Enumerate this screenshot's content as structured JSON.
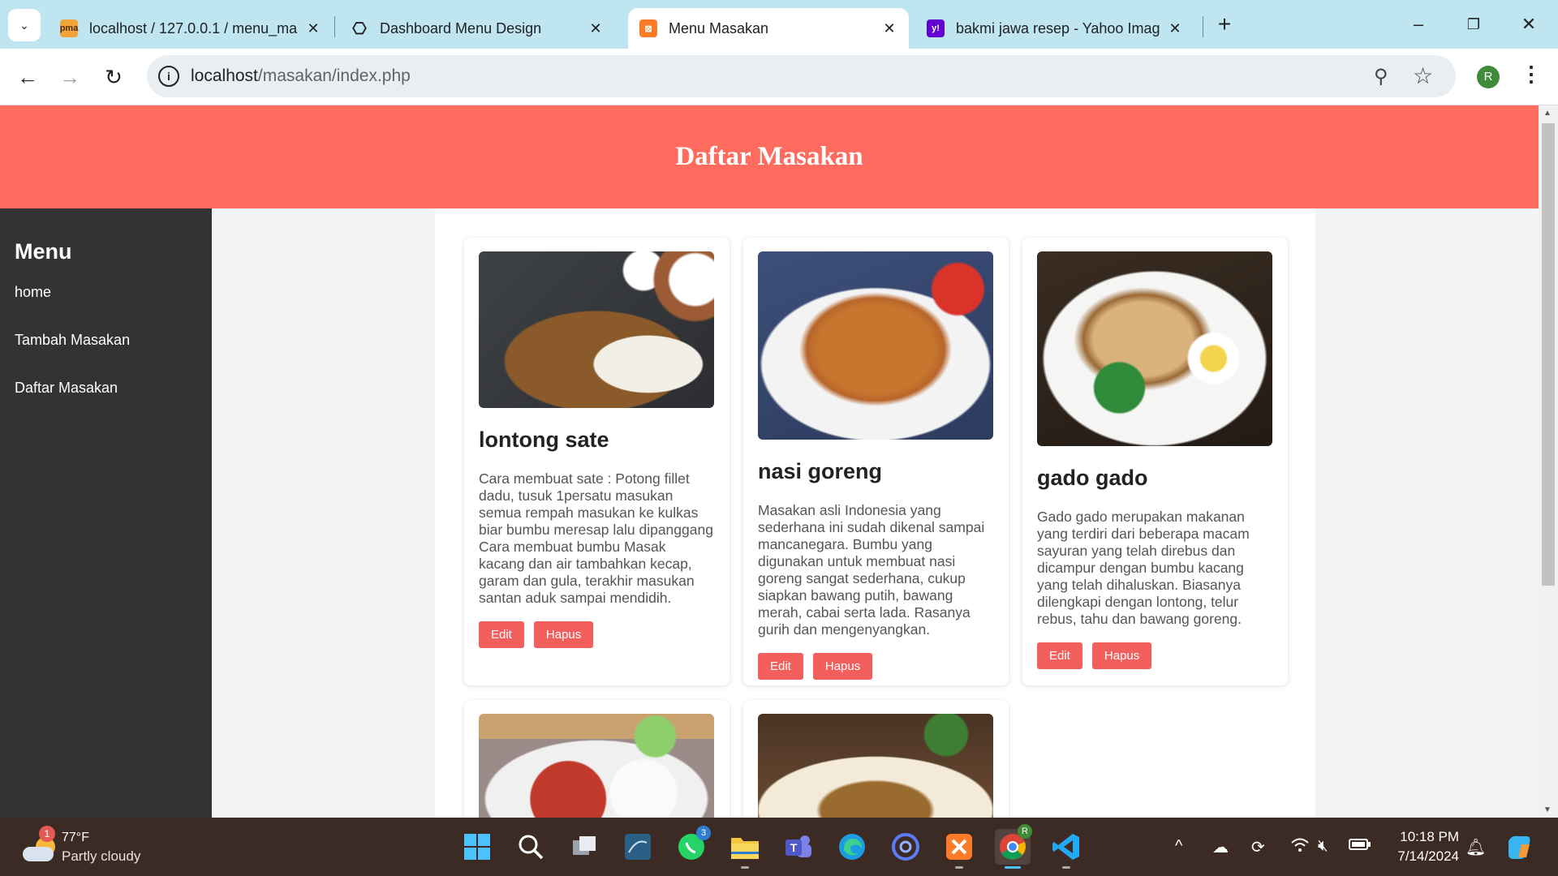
{
  "browser": {
    "tabs": [
      {
        "title": "localhost / 127.0.0.1 / menu_ma",
        "icon": "phpmyadmin-icon",
        "active": false
      },
      {
        "title": "Dashboard Menu Design",
        "icon": "chatgpt-icon",
        "active": false
      },
      {
        "title": "Menu Masakan",
        "icon": "xampp-icon",
        "active": true
      },
      {
        "title": "bakmi jawa resep - Yahoo Imag",
        "icon": "yahoo-icon",
        "active": false
      }
    ],
    "url_host": "localhost",
    "url_path": "/masakan/index.php",
    "profile_initial": "R"
  },
  "page": {
    "header_title": "Daftar Masakan",
    "sidebar": {
      "title": "Menu",
      "items": [
        "home",
        "Tambah Masakan",
        "Daftar Masakan"
      ]
    },
    "recipes": [
      {
        "name": "lontong sate",
        "description": "Cara membuat sate : Potong fillet dadu, tusuk 1persatu masukan semua rempah masukan ke kulkas biar bumbu meresap lalu dipanggang Cara membuat bumbu Masak kacang dan air tambahkan kecap, garam dan gula, terakhir masukan santan aduk sampai mendidih.",
        "image": "lontong-sate-photo"
      },
      {
        "name": "nasi goreng",
        "description": "Masakan asli Indonesia yang sederhana ini sudah dikenal sampai mancanegara. Bumbu yang digunakan untuk membuat nasi goreng sangat sederhana, cukup siapkan bawang putih, bawang merah, cabai serta lada. Rasanya gurih dan mengenyangkan.",
        "image": "nasi-goreng-photo"
      },
      {
        "name": "gado gado",
        "description": "Gado gado merupakan makanan yang terdiri dari beberapa macam sayuran yang telah direbus dan dicampur dengan bumbu kacang yang telah dihaluskan. Biasanya dilengkapi dengan lontong, telur rebus, tahu dan bawang goreng.",
        "image": "gado-gado-photo"
      }
    ],
    "partial_cards": [
      "ayam-sambal-photo",
      "mie-goreng-photo"
    ],
    "edit_label": "Edit",
    "delete_label": "Hapus",
    "colors": {
      "header": "#ff6b5e",
      "sidebar": "#333333",
      "button": "#f25f5c"
    }
  },
  "taskbar": {
    "weather_temp": "77°F",
    "weather_desc": "Partly cloudy",
    "weather_badge": "1",
    "whatsapp_badge": "3",
    "chrome_badge": "R",
    "time": "10:18 PM",
    "date": "7/14/2024"
  }
}
